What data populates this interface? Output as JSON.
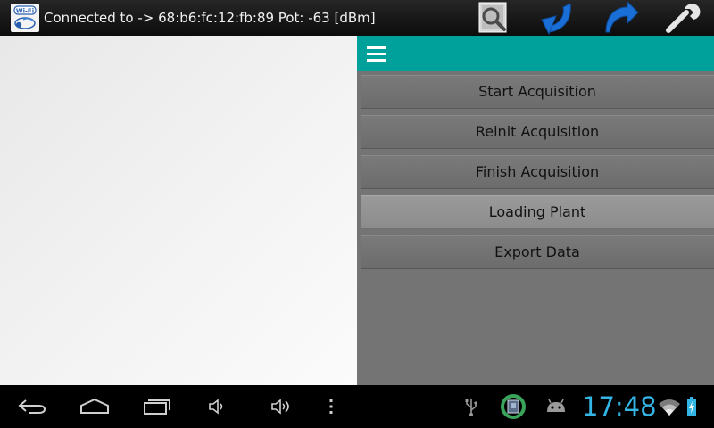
{
  "action_bar": {
    "app_icon_label": "Wi-Fi",
    "status_text": "Connected to -> 68:b6:fc:12:fb:89 Pot: -63 [dBm]",
    "actions": [
      "search-icon",
      "undo-arrow-icon",
      "redo-arrow-icon",
      "wrench-icon"
    ],
    "accent_color": "#1a6fd6"
  },
  "menu": {
    "header_color": "#00a19a",
    "items": [
      {
        "label": "Start Acquisition",
        "highlighted": false
      },
      {
        "label": "Reinit Acquisition",
        "highlighted": false
      },
      {
        "label": "Finish Acquisition",
        "highlighted": false
      },
      {
        "label": "Loading Plant",
        "highlighted": true
      },
      {
        "label": "Export Data",
        "highlighted": false
      }
    ]
  },
  "system_bar": {
    "clock": "17:48",
    "clock_color": "#33b5e5",
    "nav_icons": [
      "back-icon",
      "home-icon",
      "recent-apps-icon",
      "volume-down-icon",
      "volume-up-icon",
      "overflow-menu-icon"
    ],
    "status_icons": [
      "usb-icon",
      "sync-app-icon",
      "android-debug-icon",
      "wifi-icon",
      "battery-charging-icon"
    ]
  }
}
